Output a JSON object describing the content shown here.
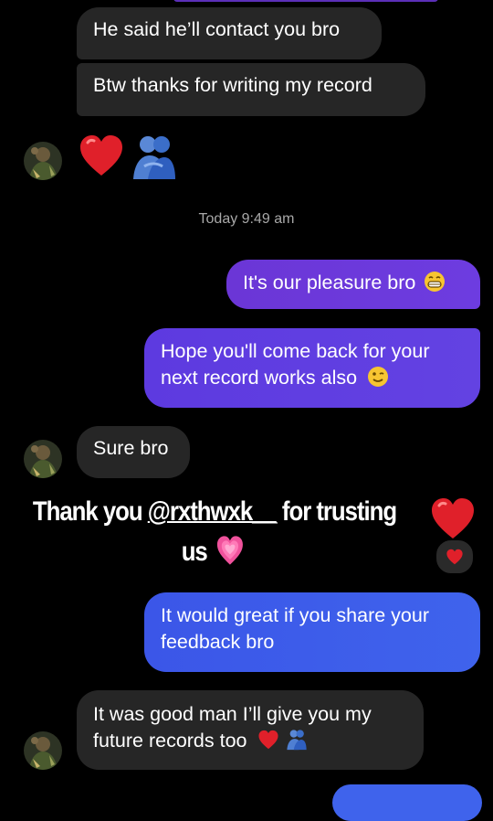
{
  "conversation": {
    "messages": {
      "m1": "He said he’ll contact you bro",
      "m2": "Btw thanks for writing my record",
      "m3": "It's our pleasure bro",
      "m4_line1": "Hope you'll come back for your",
      "m4_line2": "next record works also",
      "m5": "Sure bro",
      "m6_line1": "It would great if you share your",
      "m6_line2": "feedback bro",
      "m7_line1": "It was good man I’ll give you my",
      "m7_line2": "future records too"
    },
    "timestamp": "Today 9:49 am"
  },
  "overlay": {
    "caption_before": "Thank you ",
    "caption_mention": "@rxthwxk__",
    "caption_after": " for trusting",
    "caption_line2": "us"
  },
  "icons": {
    "heart": "red-heart-icon",
    "hug": "people-hugging-icon",
    "grin": "grinning-face-icon",
    "wink": "winking-face-icon",
    "pink_heart": "growing-heart-icon"
  },
  "colors": {
    "background": "#000000",
    "incoming_bubble": "#262626",
    "outgoing_purple": "#6b36d6",
    "outgoing_blue": "#3f63ec",
    "timestamp_text": "#a8a8a8"
  }
}
